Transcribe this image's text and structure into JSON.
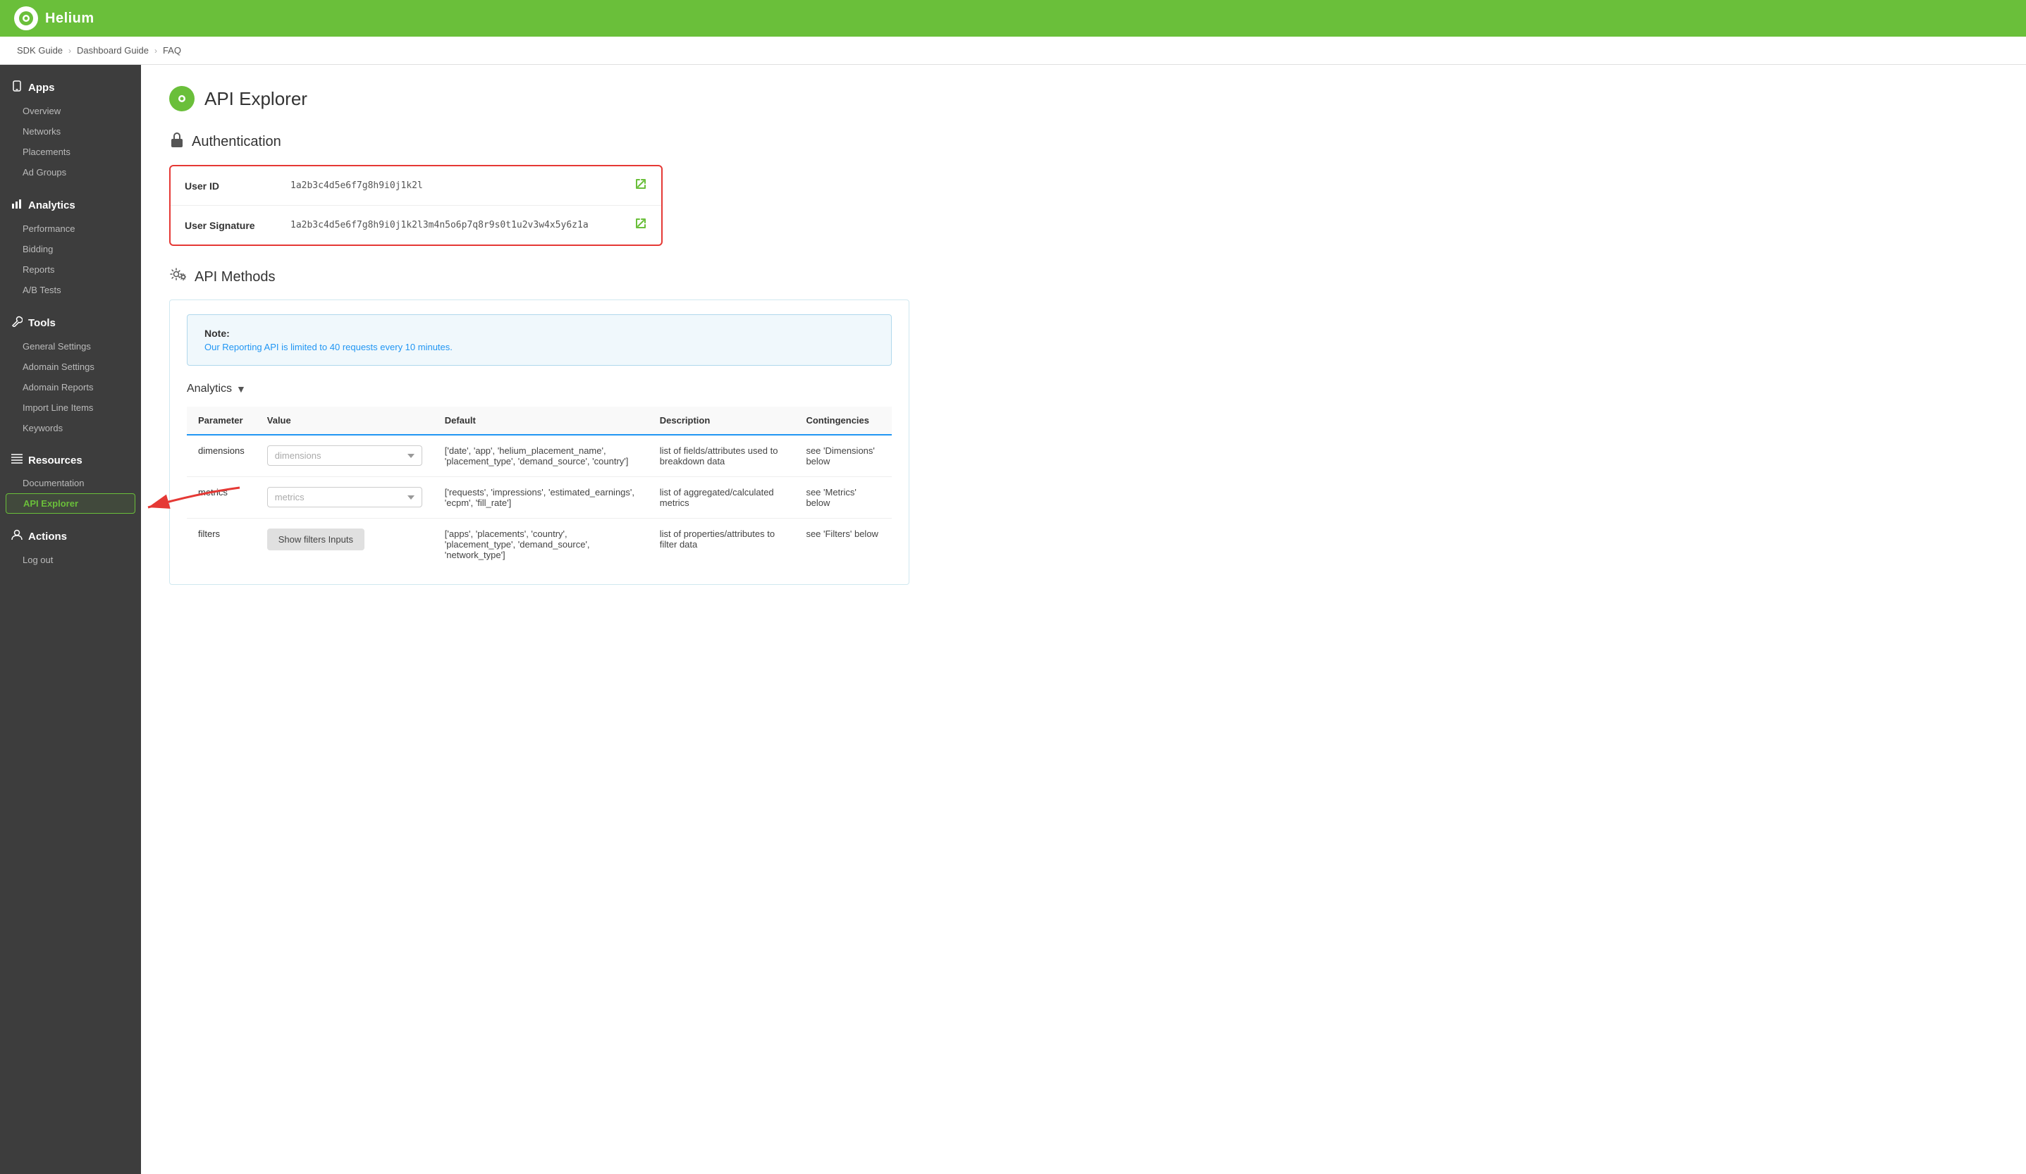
{
  "header": {
    "logo_text": "Helium"
  },
  "breadcrumb": {
    "items": [
      "SDK Guide",
      "Dashboard Guide",
      "FAQ"
    ]
  },
  "sidebar": {
    "sections": [
      {
        "id": "apps",
        "icon": "📱",
        "label": "Apps",
        "items": [
          "Overview",
          "Networks",
          "Placements",
          "Ad Groups"
        ]
      },
      {
        "id": "analytics",
        "icon": "📊",
        "label": "Analytics",
        "items": [
          "Performance",
          "Bidding",
          "Reports",
          "A/B Tests"
        ]
      },
      {
        "id": "tools",
        "icon": "🔧",
        "label": "Tools",
        "items": [
          "General Settings",
          "Adomain Settings",
          "Adomain Reports",
          "Import Line Items",
          "Keywords"
        ]
      },
      {
        "id": "resources",
        "icon": "☰",
        "label": "Resources",
        "items": [
          "Documentation",
          "API Explorer"
        ]
      },
      {
        "id": "actions",
        "icon": "👤",
        "label": "Actions",
        "items": [
          "Log out"
        ]
      }
    ]
  },
  "page": {
    "title": "API Explorer",
    "sections": {
      "authentication": {
        "title": "Authentication",
        "user_id_label": "User ID",
        "user_id_value": "1a2b3c4d5e6f7g8h9i0j1k2l",
        "user_signature_label": "User Signature",
        "user_signature_value": "1a2b3c4d5e6f7g8h9i0j1k2l3m4n5o6p7q8r9s0t1u2v3w4x5y6z1a"
      },
      "api_methods": {
        "title": "API Methods",
        "note_title": "Note:",
        "note_text": "Our Reporting API is limited to 40 requests every 10 minutes.",
        "analytics_label": "Analytics",
        "table": {
          "headers": [
            "Parameter",
            "Value",
            "Default",
            "Description",
            "Contingencies"
          ],
          "rows": [
            {
              "parameter": "dimensions",
              "value_placeholder": "dimensions",
              "default": "['date', 'app', 'helium_placement_name', 'placement_type', 'demand_source', 'country']",
              "description": "list of fields/attributes used to breakdown data",
              "contingencies": "see 'Dimensions' below"
            },
            {
              "parameter": "metrics",
              "value_placeholder": "metrics",
              "default": "['requests', 'impressions', 'estimated_earnings', 'ecpm', 'fill_rate']",
              "description": "list of aggregated/calculated metrics",
              "contingencies": "see 'Metrics' below"
            },
            {
              "parameter": "filters",
              "value_btn_label": "Show filters Inputs",
              "default": "['apps', 'placements', 'country', 'placement_type', 'demand_source', 'network_type']",
              "description": "list of properties/attributes to filter data",
              "contingencies": "see 'Filters' below"
            }
          ]
        }
      }
    }
  }
}
